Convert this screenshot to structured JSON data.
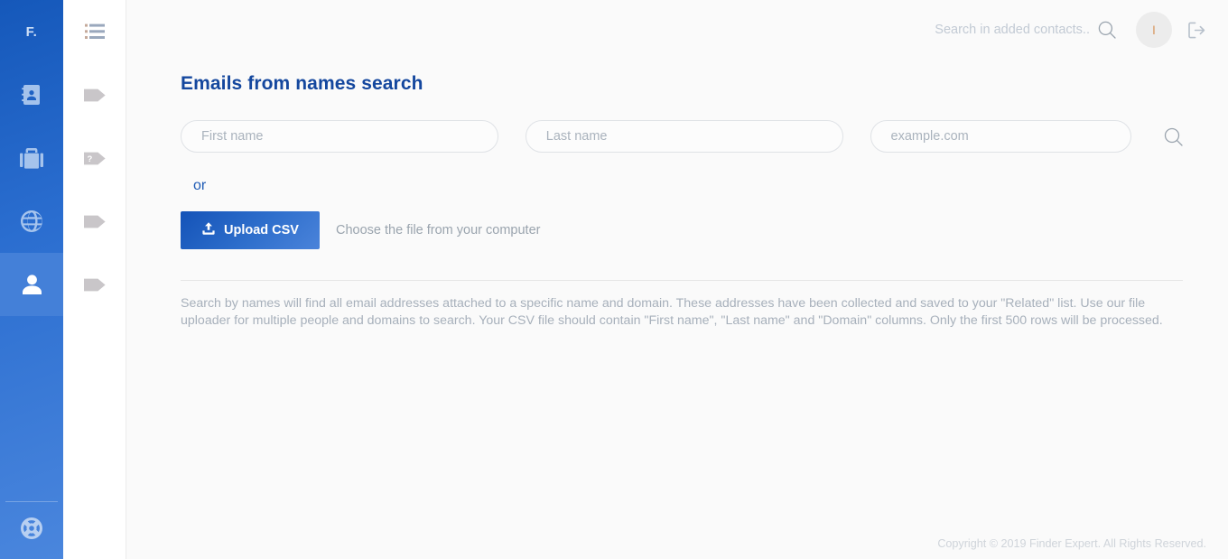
{
  "brand": {
    "logo_text": "F.",
    "accent_blue": "#2b6ed0",
    "title_blue": "#14479e"
  },
  "sidebar_primary": {
    "items": [
      {
        "name": "contacts",
        "icon": "address-book-icon",
        "active": false
      },
      {
        "name": "companies",
        "icon": "briefcase-icon",
        "active": false
      },
      {
        "name": "domains",
        "icon": "globe-icon",
        "active": false
      },
      {
        "name": "people",
        "icon": "person-icon",
        "active": true
      }
    ],
    "bottom": {
      "name": "support",
      "icon": "lifebuoy-icon"
    }
  },
  "sidebar_secondary": {
    "top": {
      "name": "list",
      "icon": "list-icon"
    },
    "items": [
      {
        "icon": "tag-icon"
      },
      {
        "icon": "tag-question-icon"
      },
      {
        "icon": "tag-icon"
      },
      {
        "icon": "tag-icon"
      }
    ]
  },
  "header": {
    "search_placeholder": "Search in added contacts..",
    "search_value": "",
    "search_icon": "search-icon",
    "avatar_initial": "I",
    "logout_icon": "logout-icon"
  },
  "main": {
    "page_title": "Emails from names search",
    "fields": {
      "first_name_placeholder": "First name",
      "first_name_value": "",
      "last_name_placeholder": "Last name",
      "last_name_value": "",
      "domain_placeholder": "example.com",
      "domain_value": ""
    },
    "search_button_icon": "search-icon",
    "or_label": "or",
    "upload_button_label": "Upload CSV",
    "upload_button_icon": "upload-icon",
    "upload_hint": "Choose the file from your computer",
    "description": "Search by names will find all email addresses attached to a specific name and domain. These addresses have been collected and saved to your \"Related\" list. Use our file uploader for multiple people and domains to search. Your CSV file should contain \"First name\", \"Last name\" and \"Domain\" columns. Only the first 500 rows will be processed."
  },
  "footer": {
    "copyright": "Copyright © 2019 Finder Expert. All Rights Reserved."
  }
}
